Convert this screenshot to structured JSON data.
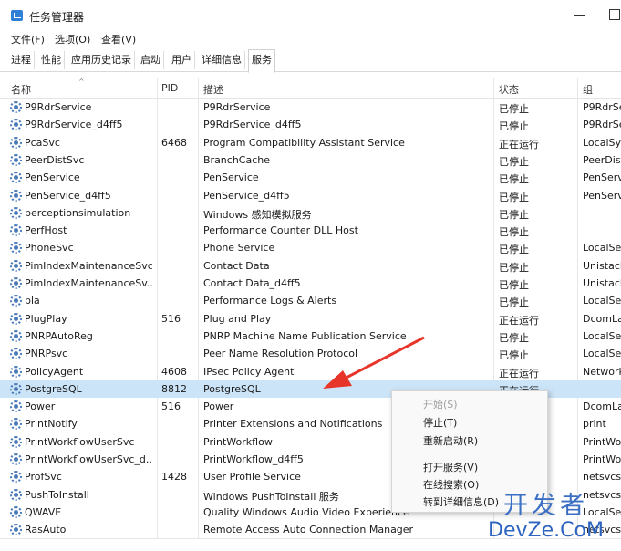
{
  "window": {
    "title": "任务管理器"
  },
  "menu": [
    "文件(F)",
    "选项(O)",
    "查看(V)"
  ],
  "tabs": [
    "进程",
    "性能",
    "应用历史记录",
    "启动",
    "用户",
    "详细信息",
    "服务"
  ],
  "columns": [
    "名称",
    "PID",
    "描述",
    "状态",
    "组"
  ],
  "rows": [
    {
      "name": "P9RdrService",
      "pid": "",
      "desc": "P9RdrService",
      "status": "已停止",
      "group": "P9RdrSe"
    },
    {
      "name": "P9RdrService_d4ff5",
      "pid": "",
      "desc": "P9RdrService_d4ff5",
      "status": "已停止",
      "group": "P9RdrSe"
    },
    {
      "name": "PcaSvc",
      "pid": "6468",
      "desc": "Program Compatibility Assistant Service",
      "status": "正在运行",
      "group": "LocalSys"
    },
    {
      "name": "PeerDistSvc",
      "pid": "",
      "desc": "BranchCache",
      "status": "已停止",
      "group": "PeerDist"
    },
    {
      "name": "PenService",
      "pid": "",
      "desc": "PenService",
      "status": "已停止",
      "group": "PenServ"
    },
    {
      "name": "PenService_d4ff5",
      "pid": "",
      "desc": "PenService_d4ff5",
      "status": "已停止",
      "group": "PenServ"
    },
    {
      "name": "perceptionsimulation",
      "pid": "",
      "desc": "Windows 感知模拟服务",
      "status": "已停止",
      "group": ""
    },
    {
      "name": "PerfHost",
      "pid": "",
      "desc": "Performance Counter DLL Host",
      "status": "已停止",
      "group": ""
    },
    {
      "name": "PhoneSvc",
      "pid": "",
      "desc": "Phone Service",
      "status": "已停止",
      "group": "LocalSer"
    },
    {
      "name": "PimIndexMaintenanceSvc",
      "pid": "",
      "desc": "Contact Data",
      "status": "已停止",
      "group": "Unistack"
    },
    {
      "name": "PimIndexMaintenanceSv...",
      "pid": "",
      "desc": "Contact Data_d4ff5",
      "status": "已停止",
      "group": "Unistack"
    },
    {
      "name": "pla",
      "pid": "",
      "desc": "Performance Logs & Alerts",
      "status": "已停止",
      "group": "LocalSer"
    },
    {
      "name": "PlugPlay",
      "pid": "516",
      "desc": "Plug and Play",
      "status": "正在运行",
      "group": "DcomLa"
    },
    {
      "name": "PNRPAutoReg",
      "pid": "",
      "desc": "PNRP Machine Name Publication Service",
      "status": "已停止",
      "group": "LocalSer"
    },
    {
      "name": "PNRPsvc",
      "pid": "",
      "desc": "Peer Name Resolution Protocol",
      "status": "已停止",
      "group": "LocalSer"
    },
    {
      "name": "PolicyAgent",
      "pid": "4608",
      "desc": "IPsec Policy Agent",
      "status": "正在运行",
      "group": "Network"
    },
    {
      "name": "PostgreSQL",
      "pid": "8812",
      "desc": "PostgreSQL",
      "status": "正在运行",
      "group": ""
    },
    {
      "name": "Power",
      "pid": "516",
      "desc": "Power",
      "status": "",
      "group": "DcomLa"
    },
    {
      "name": "PrintNotify",
      "pid": "",
      "desc": "Printer Extensions and Notifications",
      "status": "",
      "group": "print"
    },
    {
      "name": "PrintWorkflowUserSvc",
      "pid": "",
      "desc": "PrintWorkflow",
      "status": "",
      "group": "PrintWo"
    },
    {
      "name": "PrintWorkflowUserSvc_d...",
      "pid": "",
      "desc": "PrintWorkflow_d4ff5",
      "status": "",
      "group": "PrintWo"
    },
    {
      "name": "ProfSvc",
      "pid": "1428",
      "desc": "User Profile Service",
      "status": "",
      "group": "netsvcs"
    },
    {
      "name": "PushToInstall",
      "pid": "",
      "desc": "Windows PushToInstall 服务",
      "status": "",
      "group": "netsvcs"
    },
    {
      "name": "QWAVE",
      "pid": "",
      "desc": "Quality Windows Audio Video Experience",
      "status": "",
      "group": "LocalSer"
    },
    {
      "name": "RasAuto",
      "pid": "",
      "desc": "Remote Access Auto Connection Manager",
      "status": "",
      "group": "netsvcs"
    }
  ],
  "selected_row": "PostgreSQL",
  "context_menu": {
    "items": [
      {
        "label": "开始(S)",
        "enabled": false
      },
      {
        "label": "停止(T)",
        "enabled": true
      },
      {
        "label": "重新启动(R)",
        "enabled": true
      },
      {
        "label": "打开服务(V)",
        "enabled": true
      },
      {
        "label": "在线搜索(O)",
        "enabled": true
      },
      {
        "label": "转到详细信息(D)",
        "enabled": true
      }
    ]
  },
  "watermark": {
    "cn": "开发者",
    "en": "DevZe.CoM"
  },
  "colors": {
    "selected_row": "#cce4f7",
    "arrow": "#e8352a",
    "watermark": "#3b6fc4"
  }
}
